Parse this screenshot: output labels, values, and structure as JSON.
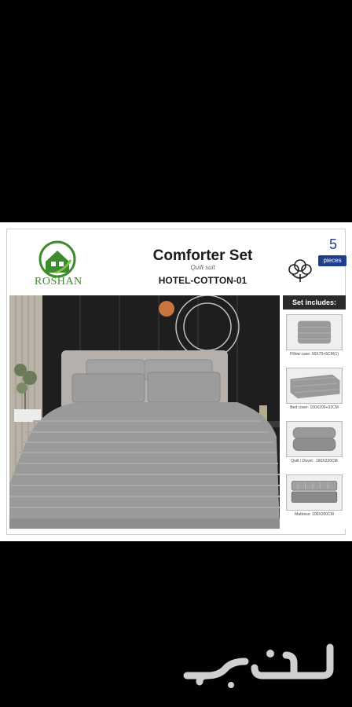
{
  "brand": {
    "name": "ROSHAN"
  },
  "header": {
    "title": "Comforter Set",
    "subtitle": "Quilt suit",
    "model": "HOTEL-COTTON-01",
    "piece_count": "5",
    "piece_label": "pieces"
  },
  "set_includes": {
    "heading": "Set includes:",
    "items": [
      {
        "caption": "Pillow case: 50X75+5CM(1)",
        "icon": "pillow-image"
      },
      {
        "caption": "Bed cover: 100X200+32CM",
        "icon": "fitted-sheet-image"
      },
      {
        "caption": "Quilt / Duvet : 160X220CM",
        "icon": "folded-quilt-image"
      },
      {
        "caption": "Mattress: 100X200CM",
        "icon": "mattress-image"
      }
    ]
  },
  "colors": {
    "background": "#000000",
    "brand_green": "#3d8b2c",
    "badge_blue": "#1f3f8c",
    "bedding_gray": "#9a9a9a",
    "wall_dark": "#1e1e1e"
  },
  "watermark": {
    "icon": "haraj-watermark"
  }
}
